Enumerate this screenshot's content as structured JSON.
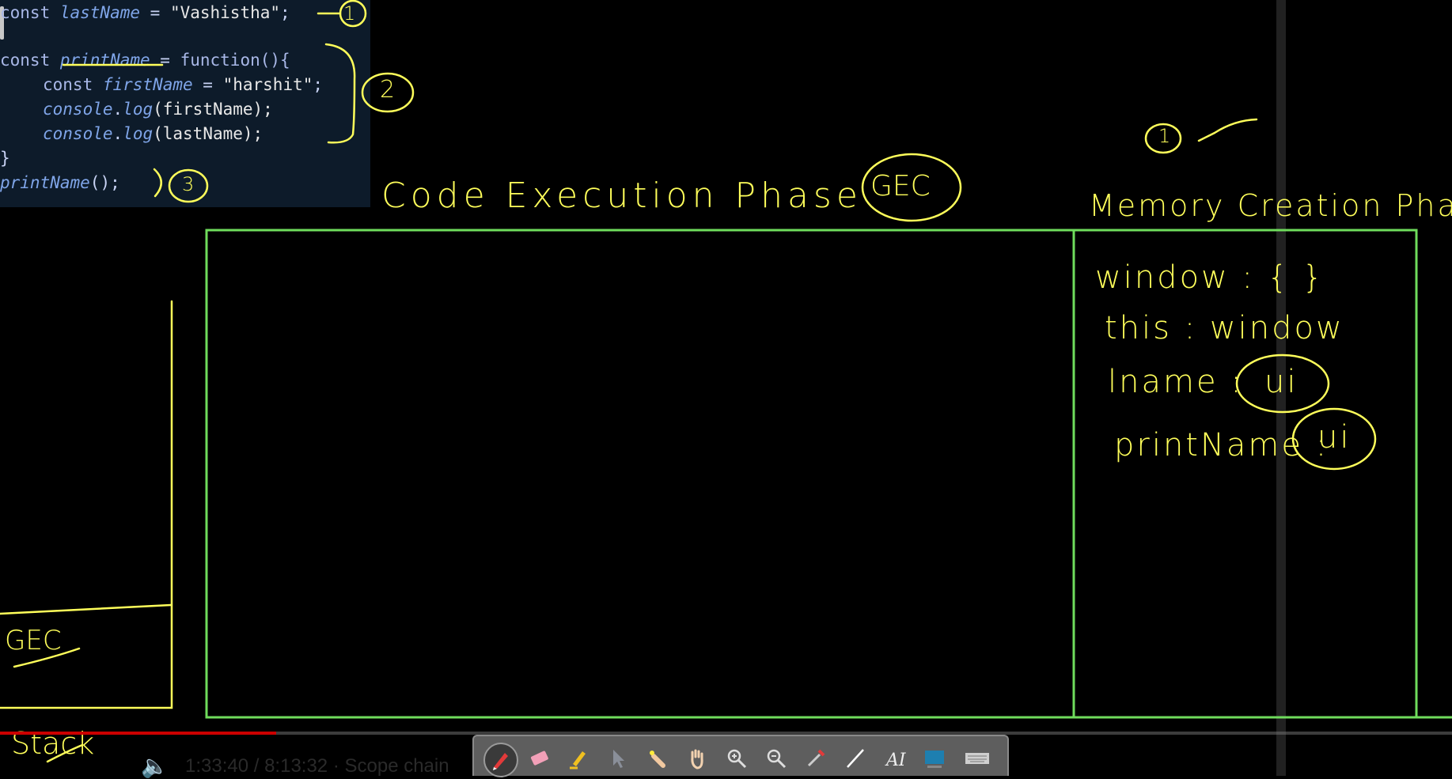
{
  "code": {
    "line1": {
      "kw": "const ",
      "name": "lastName",
      "op": " = ",
      "str": "\"Vashistha\"",
      "end": ";"
    },
    "line2": {
      "kw": "const ",
      "name": "printName",
      "op": " = ",
      "rest": "function(){"
    },
    "line3": {
      "kw": "const ",
      "name": "firstName",
      "op": " = ",
      "str": "\"harshit\"",
      "end": ";"
    },
    "line4": {
      "obj": "console",
      "dot": ".",
      "fn": "log",
      "args": "(firstName);"
    },
    "line5": {
      "obj": "console",
      "dot": ".",
      "fn": "log",
      "args": "(lastName);"
    },
    "line6": {
      "text": "}"
    },
    "line7": {
      "name": "printName",
      "rest": "();"
    }
  },
  "annotations": {
    "circle1": "1",
    "circle2": "2",
    "circle3": "3",
    "top_right_circle": "1",
    "gec_circle": "GEC",
    "stack_label": "GEC",
    "stack_caption": "Stack"
  },
  "headings": {
    "code_execution": "Code Execution Phase",
    "memory_creation": "Memory Creation Phase"
  },
  "memory": {
    "window": "window : {   }",
    "this": "this : window",
    "lname_key": "lname :",
    "lname_val": "ui",
    "printname_key": "printName :",
    "printname_val": "ui"
  },
  "player": {
    "time": "1:33:40 / 8:13:32",
    "chapter": "· Scope chain",
    "progress": 0.19
  },
  "toolbar": {
    "tools": [
      "pen",
      "eraser",
      "highlighter",
      "select",
      "laser",
      "pan",
      "zoom-in",
      "zoom-out",
      "color-picker",
      "line",
      "text",
      "screen",
      "keyboard"
    ]
  },
  "colors": {
    "ink": "#ffff5a",
    "frame": "#6fdc5c",
    "code_bg": "#0d1b2a"
  }
}
